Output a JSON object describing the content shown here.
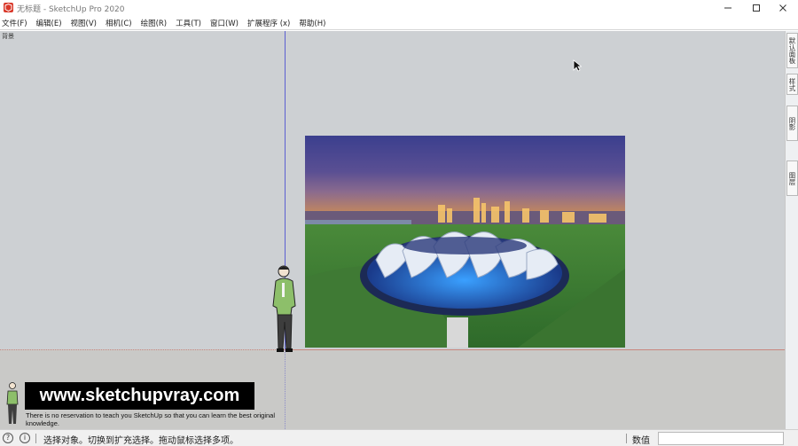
{
  "window": {
    "title": "无标题 - SketchUp Pro 2020",
    "icon": "sketchup-logo-icon",
    "controls": [
      "minimize-icon",
      "maximize-icon",
      "close-icon"
    ]
  },
  "menu": {
    "items": [
      "文件(F)",
      "编辑(E)",
      "视图(V)",
      "相机(C)",
      "绘图(R)",
      "工具(T)",
      "窗口(W)",
      "扩展程序 (x)",
      "帮助(H)"
    ]
  },
  "viewport": {
    "scene_label": "背景",
    "colors": {
      "sky": "#cdd0d3",
      "ground": "#c9c9c7",
      "red_axis": "#c9867e",
      "blue_axis": "#5b5fd1"
    }
  },
  "watermark": {
    "url": "www.sketchupvray.com",
    "note": "There is no reservation to teach you SketchUp so that you can learn the best original knowledge."
  },
  "tray": {
    "tabs": [
      "默认面板",
      "样式",
      "阴影",
      "图层"
    ]
  },
  "status": {
    "message": "选择对象。切换到扩充选择。拖动鼠标选择多项。",
    "value_label": "数值",
    "value": ""
  }
}
